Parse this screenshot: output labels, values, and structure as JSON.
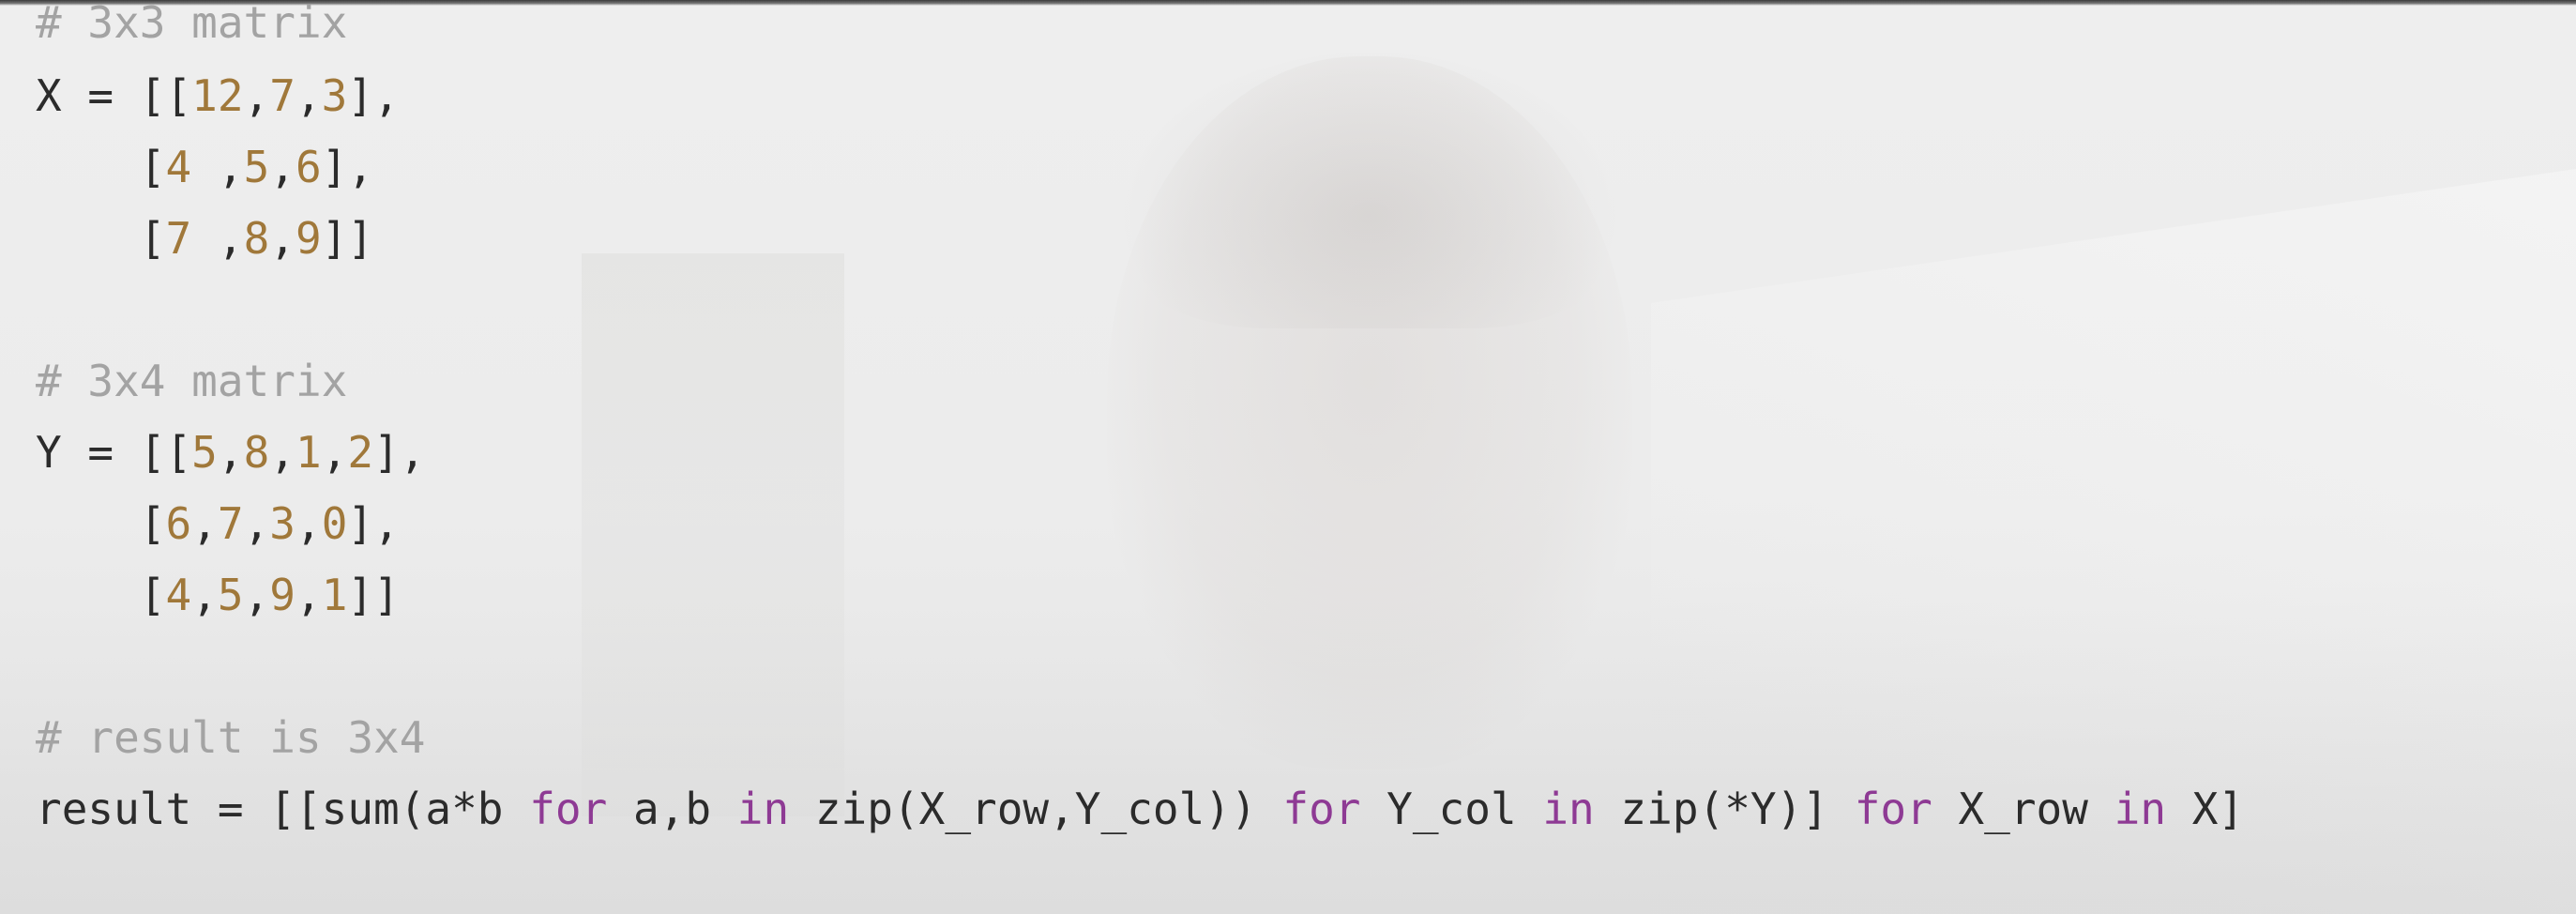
{
  "code_editor": {
    "lines": [
      {
        "kind": "comment",
        "text": "# 3x3 matrix"
      },
      {
        "kind": "code",
        "segments": [
          {
            "t": "plain",
            "v": "X = [["
          },
          {
            "t": "num",
            "v": "12"
          },
          {
            "t": "plain",
            "v": ","
          },
          {
            "t": "num",
            "v": "7"
          },
          {
            "t": "plain",
            "v": ","
          },
          {
            "t": "num",
            "v": "3"
          },
          {
            "t": "plain",
            "v": "],"
          }
        ]
      },
      {
        "kind": "code",
        "segments": [
          {
            "t": "plain",
            "v": "    ["
          },
          {
            "t": "num",
            "v": "4"
          },
          {
            "t": "plain",
            "v": " ,"
          },
          {
            "t": "num",
            "v": "5"
          },
          {
            "t": "plain",
            "v": ","
          },
          {
            "t": "num",
            "v": "6"
          },
          {
            "t": "plain",
            "v": "],"
          }
        ]
      },
      {
        "kind": "code",
        "segments": [
          {
            "t": "plain",
            "v": "    ["
          },
          {
            "t": "num",
            "v": "7"
          },
          {
            "t": "plain",
            "v": " ,"
          },
          {
            "t": "num",
            "v": "8"
          },
          {
            "t": "plain",
            "v": ","
          },
          {
            "t": "num",
            "v": "9"
          },
          {
            "t": "plain",
            "v": "]]"
          }
        ]
      },
      {
        "kind": "blank",
        "text": ""
      },
      {
        "kind": "comment",
        "text": "# 3x4 matrix"
      },
      {
        "kind": "code",
        "segments": [
          {
            "t": "plain",
            "v": "Y = [["
          },
          {
            "t": "num",
            "v": "5"
          },
          {
            "t": "plain",
            "v": ","
          },
          {
            "t": "num",
            "v": "8"
          },
          {
            "t": "plain",
            "v": ","
          },
          {
            "t": "num",
            "v": "1"
          },
          {
            "t": "plain",
            "v": ","
          },
          {
            "t": "num",
            "v": "2"
          },
          {
            "t": "plain",
            "v": "],"
          }
        ]
      },
      {
        "kind": "code",
        "segments": [
          {
            "t": "plain",
            "v": "    ["
          },
          {
            "t": "num",
            "v": "6"
          },
          {
            "t": "plain",
            "v": ","
          },
          {
            "t": "num",
            "v": "7"
          },
          {
            "t": "plain",
            "v": ","
          },
          {
            "t": "num",
            "v": "3"
          },
          {
            "t": "plain",
            "v": ","
          },
          {
            "t": "num",
            "v": "0"
          },
          {
            "t": "plain",
            "v": "],"
          }
        ]
      },
      {
        "kind": "code",
        "segments": [
          {
            "t": "plain",
            "v": "    ["
          },
          {
            "t": "num",
            "v": "4"
          },
          {
            "t": "plain",
            "v": ","
          },
          {
            "t": "num",
            "v": "5"
          },
          {
            "t": "plain",
            "v": ","
          },
          {
            "t": "num",
            "v": "9"
          },
          {
            "t": "plain",
            "v": ","
          },
          {
            "t": "num",
            "v": "1"
          },
          {
            "t": "plain",
            "v": "]]"
          }
        ]
      },
      {
        "kind": "blank",
        "text": ""
      },
      {
        "kind": "comment",
        "text": "# result is 3x4"
      },
      {
        "kind": "code",
        "segments": [
          {
            "t": "plain",
            "v": "result = [[sum(a*b "
          },
          {
            "t": "kw",
            "v": "for"
          },
          {
            "t": "plain",
            "v": " a,b "
          },
          {
            "t": "kw",
            "v": "in"
          },
          {
            "t": "plain",
            "v": " zip(X_row,Y_col)) "
          },
          {
            "t": "kw",
            "v": "for"
          },
          {
            "t": "plain",
            "v": " Y_col "
          },
          {
            "t": "kw",
            "v": "in"
          },
          {
            "t": "plain",
            "v": " zip(*Y)] "
          },
          {
            "t": "kw",
            "v": "for"
          },
          {
            "t": "plain",
            "v": " X_row "
          },
          {
            "t": "kw",
            "v": "in"
          },
          {
            "t": "plain",
            "v": " X]"
          }
        ]
      }
    ]
  },
  "colors": {
    "background": "#eeeeee",
    "comment": "#a3a3a3",
    "number": "#a0783a",
    "keyword": "#8e3a94",
    "text": "#2b2b2b"
  }
}
